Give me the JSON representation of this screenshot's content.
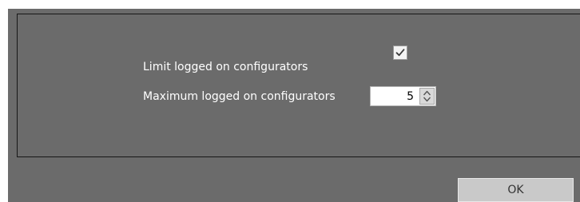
{
  "settings": {
    "limit_logged_on": {
      "label": "Limit logged on configurators",
      "checked": true
    },
    "max_logged_on": {
      "label": "Maximum logged on configurators",
      "value": "5"
    }
  },
  "footer": {
    "ok_label": "OK"
  }
}
